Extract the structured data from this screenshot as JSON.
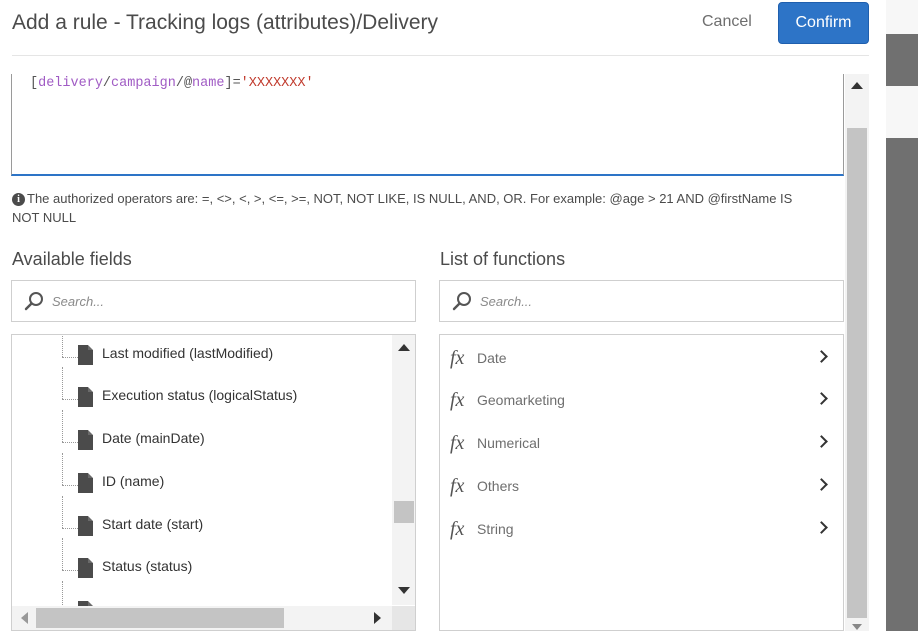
{
  "dialog": {
    "title": "Add a rule - Tracking logs (attributes)/Delivery",
    "cancel_label": "Cancel",
    "confirm_label": "Confirm"
  },
  "expression": {
    "open_bracket": "[",
    "path1": "delivery",
    "sep1": "/",
    "path2": "campaign",
    "sep2": "/@",
    "path3": "name",
    "close_bracket": "]",
    "operator": "=",
    "quote_open": "'",
    "value": "XXXXXXX",
    "quote_close": "'"
  },
  "hint": {
    "text": "The authorized operators are: =, <>, <, >, <=, >=, NOT, NOT LIKE, IS NULL, AND, OR. For example: @age > 21 AND @firstName IS NOT NULL"
  },
  "available_fields": {
    "heading": "Available fields",
    "search_placeholder": "Search...",
    "items": [
      {
        "label": "Last modified (lastModified)",
        "icon": "document-icon"
      },
      {
        "label": "Execution status (logicalStatus)",
        "icon": "document-icon"
      },
      {
        "label": "Date (mainDate)",
        "icon": "document-icon"
      },
      {
        "label": "ID (name)",
        "icon": "document-icon"
      },
      {
        "label": "Start date (start)",
        "icon": "document-icon"
      },
      {
        "label": "Status (status)",
        "icon": "document-icon"
      }
    ]
  },
  "functions": {
    "heading": "List of functions",
    "search_placeholder": "Search...",
    "items": [
      {
        "label": "Date",
        "icon": "fx-icon"
      },
      {
        "label": "Geomarketing",
        "icon": "fx-icon"
      },
      {
        "label": "Numerical",
        "icon": "fx-icon"
      },
      {
        "label": "Others",
        "icon": "fx-icon"
      },
      {
        "label": "String",
        "icon": "fx-icon"
      }
    ]
  },
  "colors": {
    "accent": "#2d74c7",
    "path": "#a05bc4",
    "string": "#c0392b"
  }
}
